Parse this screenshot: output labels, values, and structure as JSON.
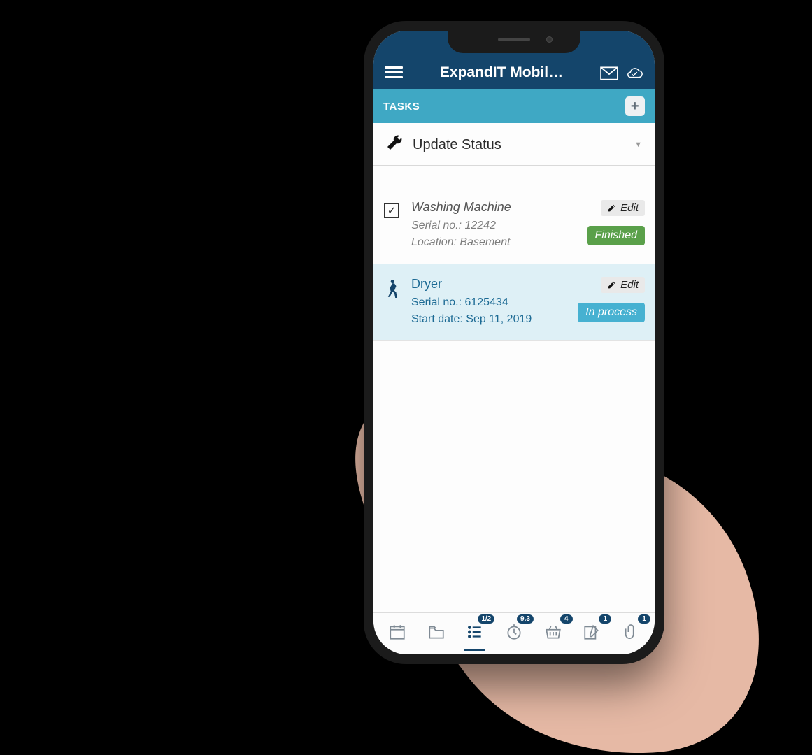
{
  "header": {
    "title": "ExpandIT Mobil…"
  },
  "tasks_bar": {
    "label": "TASKS"
  },
  "update_status": {
    "label": "Update Status"
  },
  "tasks": [
    {
      "title": "Washing Machine",
      "serial_label": "Serial no.: 12242",
      "extra_label": "Location: Basement",
      "edit_label": "Edit",
      "status_label": "Finished",
      "status_key": "finished"
    },
    {
      "title": "Dryer",
      "serial_label": "Serial no.: 6125434",
      "extra_label": "Start date: Sep 11, 2019",
      "edit_label": "Edit",
      "status_label": "In process",
      "status_key": "inprocess"
    }
  ],
  "tabbar": {
    "items": [
      {
        "icon": "calendar",
        "badge": null
      },
      {
        "icon": "folder",
        "badge": null
      },
      {
        "icon": "list",
        "badge": "1/2",
        "active": true
      },
      {
        "icon": "clock",
        "badge": "9.3"
      },
      {
        "icon": "basket",
        "badge": "4"
      },
      {
        "icon": "compose",
        "badge": "1"
      },
      {
        "icon": "clip",
        "badge": "1"
      }
    ]
  }
}
